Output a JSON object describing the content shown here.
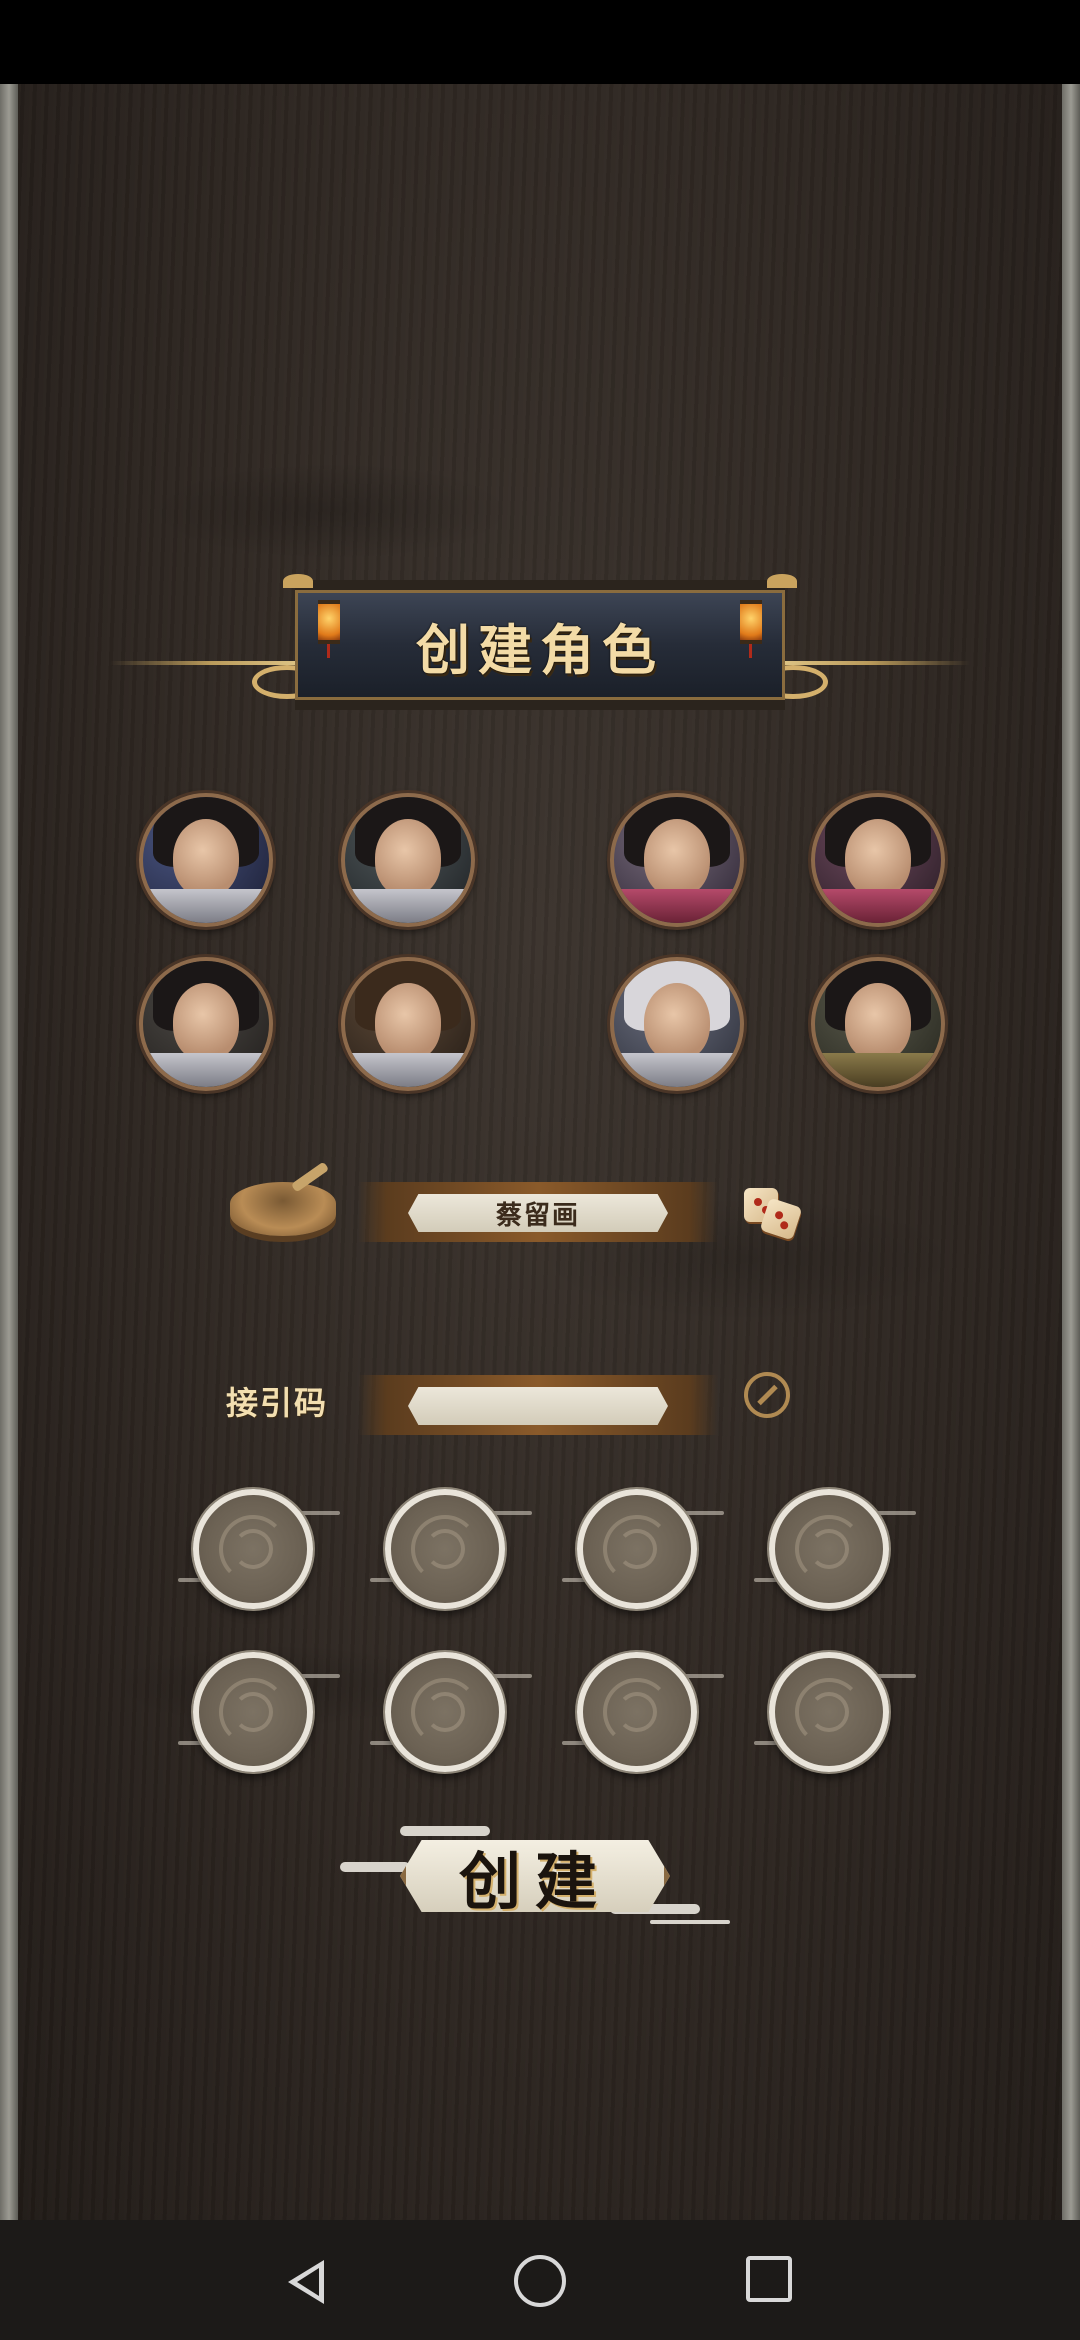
{
  "screen": {
    "title": "创建角色"
  },
  "characters": {
    "male": [
      {
        "id": "male-1"
      },
      {
        "id": "male-2"
      },
      {
        "id": "male-3"
      },
      {
        "id": "male-4"
      }
    ],
    "female": [
      {
        "id": "female-1"
      },
      {
        "id": "female-2"
      },
      {
        "id": "female-3"
      },
      {
        "id": "female-4"
      }
    ]
  },
  "name_field": {
    "value": "蔡留画",
    "randomize_icon": "dice-icon",
    "left_icon": "mortar-icon"
  },
  "invite": {
    "label": "接引码",
    "value": "",
    "edit_icon": "edit-icon"
  },
  "attribute_slots": {
    "count": 8
  },
  "create_button": {
    "label": "创建"
  },
  "navigation": {
    "back_icon": "back-triangle-icon",
    "home_icon": "home-circle-icon",
    "recent_icon": "recent-square-icon"
  }
}
